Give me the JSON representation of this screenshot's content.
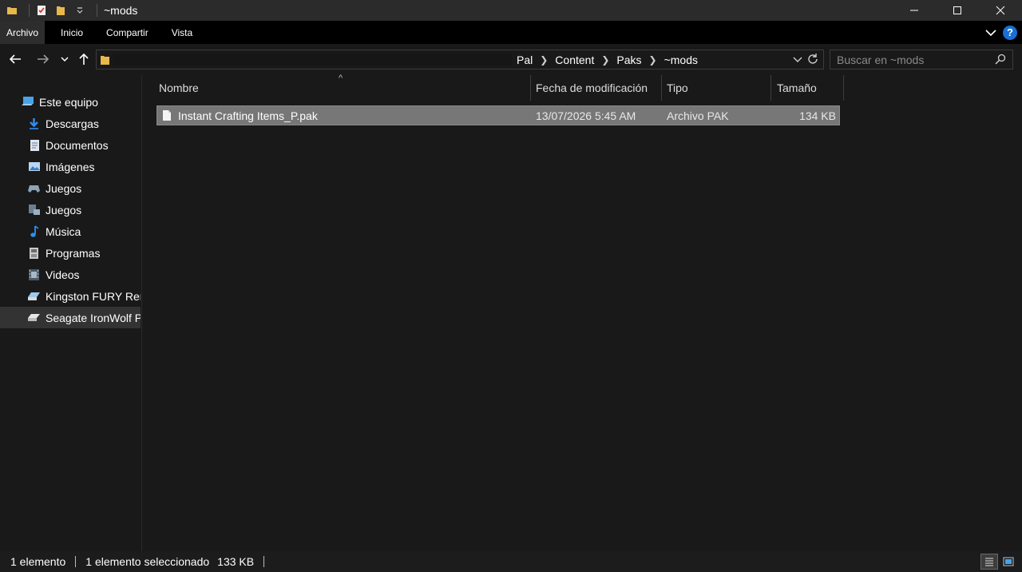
{
  "window": {
    "title": "~mods",
    "quick_access_icons": [
      "folder-icon",
      "properties-icon",
      "new-folder-icon",
      "customize-dropdown-icon"
    ],
    "controls": [
      "minimize-icon",
      "maximize-icon",
      "close-icon"
    ]
  },
  "ribbon": {
    "tabs": [
      {
        "label": "Archivo",
        "active": true
      },
      {
        "label": "Inicio",
        "active": false
      },
      {
        "label": "Compartir",
        "active": false
      },
      {
        "label": "Vista",
        "active": false
      }
    ]
  },
  "nav": {
    "breadcrumbs": [
      "Pal",
      "Content",
      "Paks",
      "~mods"
    ],
    "search_placeholder": "Buscar en ~mods"
  },
  "sidebar": {
    "items": [
      {
        "label": "Este equipo",
        "icon": "computer-icon",
        "level": 0,
        "selected": false
      },
      {
        "label": "Descargas",
        "icon": "downloads-icon",
        "level": 1,
        "selected": false
      },
      {
        "label": "Documentos",
        "icon": "documents-icon",
        "level": 1,
        "selected": false
      },
      {
        "label": "Imágenes",
        "icon": "pictures-icon",
        "level": 1,
        "selected": false
      },
      {
        "label": "Juegos",
        "icon": "gamepad-icon",
        "level": 1,
        "selected": false
      },
      {
        "label": "Juegos",
        "icon": "games-folder-icon",
        "level": 1,
        "selected": false
      },
      {
        "label": "Música",
        "icon": "music-icon",
        "level": 1,
        "selected": false
      },
      {
        "label": "Programas",
        "icon": "programs-icon",
        "level": 1,
        "selected": false
      },
      {
        "label": "Videos",
        "icon": "videos-icon",
        "level": 1,
        "selected": false
      },
      {
        "label": "Kingston FURY Rene",
        "icon": "drive-icon",
        "level": 1,
        "selected": false
      },
      {
        "label": "Seagate IronWolf Pr",
        "icon": "drive-icon",
        "level": 1,
        "selected": true
      }
    ]
  },
  "table": {
    "columns": [
      "Nombre",
      "Fecha de modificación",
      "Tipo",
      "Tamaño"
    ],
    "sort_column": "Nombre",
    "rows": [
      {
        "name": "Instant Crafting Items_P.pak",
        "modified": "13/07/2026 5:45 AM",
        "type": "Archivo PAK",
        "size": "134 KB",
        "selected": true
      }
    ]
  },
  "status": {
    "item_count": "1 elemento",
    "selection": "1 elemento seleccionado",
    "selection_size": "133 KB",
    "views": [
      "details-view-icon",
      "large-icons-view-icon"
    ]
  },
  "colors": {
    "background": "#191919",
    "selected_row": "#777777",
    "accent": "#1a6fd4"
  }
}
